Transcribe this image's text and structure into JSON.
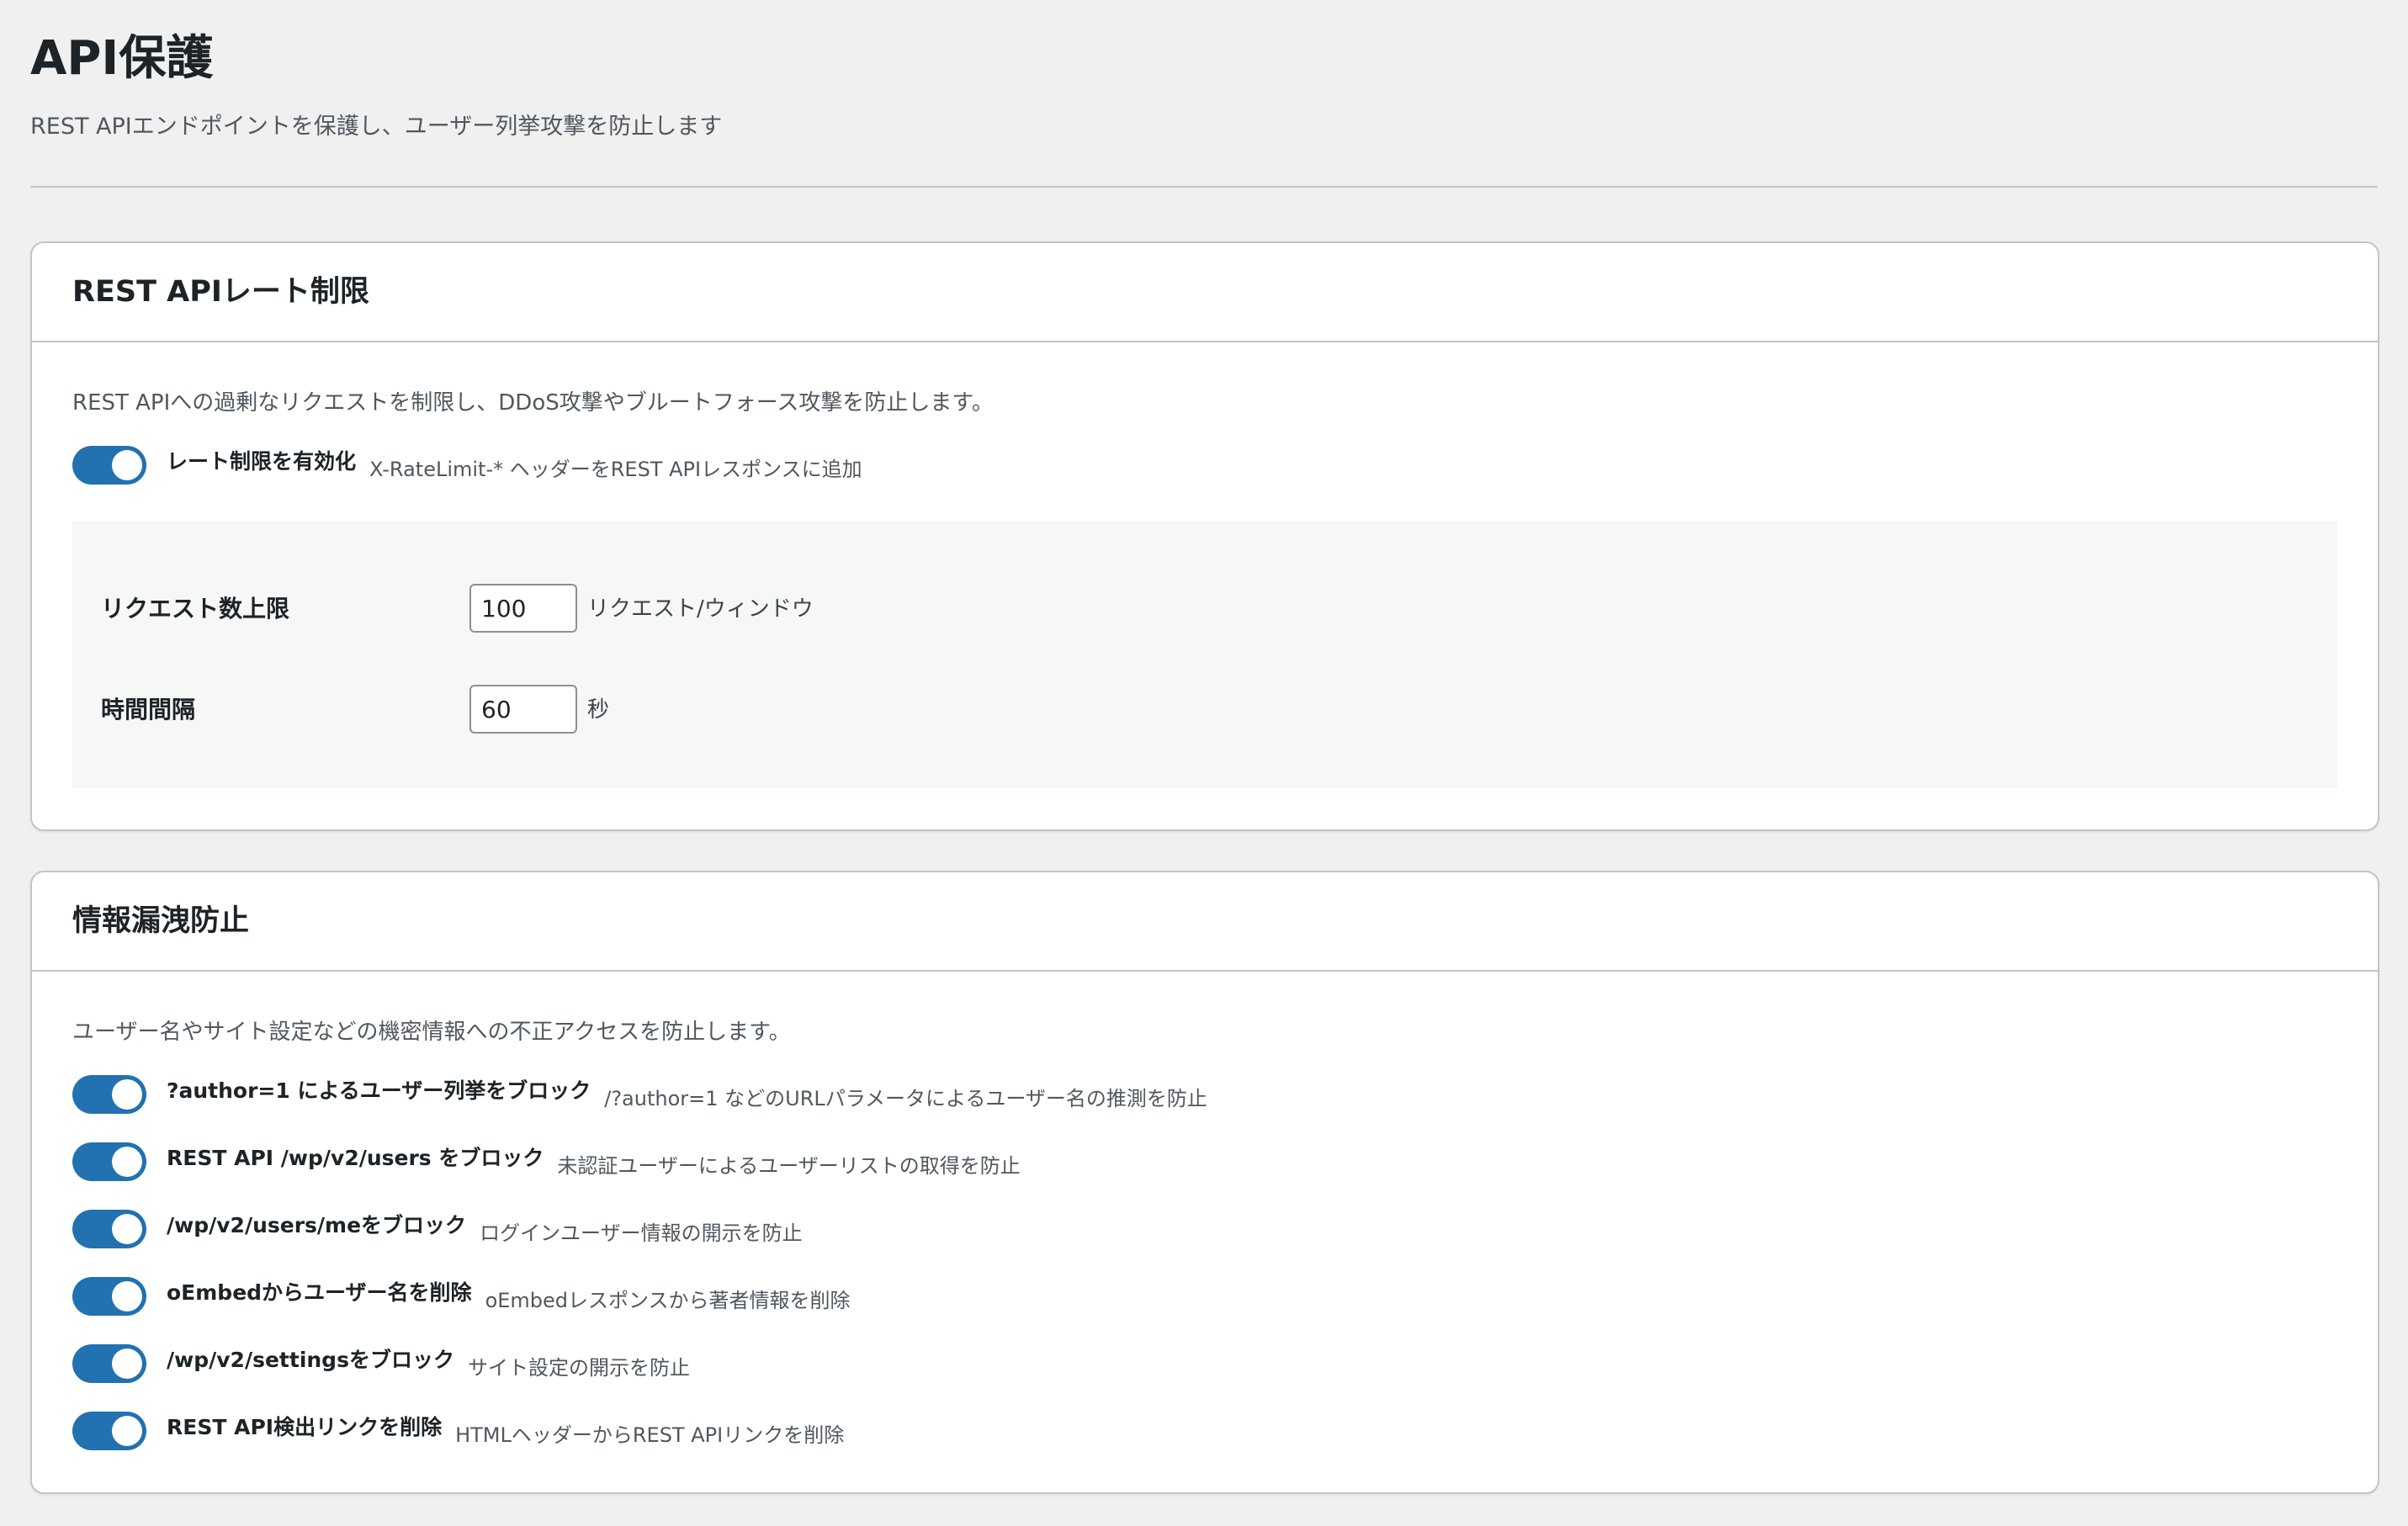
{
  "page": {
    "title": "API保護",
    "description": "REST APIエンドポイントを保護し、ユーザー列挙攻撃を防止します"
  },
  "colors": {
    "accent": "#2271b1",
    "background": "#f0f0f1",
    "card": "#ffffff",
    "panel": "#f6f7f7",
    "border": "#c3c4c7"
  },
  "rate_limit": {
    "title": "REST APIレート制限",
    "description": "REST APIへの過剰なリクエストを制限し、DDoS攻撃やブルートフォース攻撃を防止します。",
    "toggle": {
      "label": "レート制限を有効化",
      "hint": "X-RateLimit-* ヘッダーをREST APIレスポンスに追加",
      "checked": true
    },
    "fields": [
      {
        "label": "リクエスト数上限",
        "value": "100",
        "unit": "リクエスト/ウィンドウ"
      },
      {
        "label": "時間間隔",
        "value": "60",
        "unit": "秒"
      }
    ]
  },
  "info_leak": {
    "title": "情報漏洩防止",
    "description": "ユーザー名やサイト設定などの機密情報への不正アクセスを防止します。",
    "toggles": [
      {
        "label": "?author=1 によるユーザー列挙をブロック",
        "hint": "/?author=1 などのURLパラメータによるユーザー名の推測を防止",
        "checked": true
      },
      {
        "label": "REST API /wp/v2/users をブロック",
        "hint": "未認証ユーザーによるユーザーリストの取得を防止",
        "checked": true
      },
      {
        "label": "/wp/v2/users/meをブロック",
        "hint": "ログインユーザー情報の開示を防止",
        "checked": true
      },
      {
        "label": "oEmbedからユーザー名を削除",
        "hint": "oEmbedレスポンスから著者情報を削除",
        "checked": true
      },
      {
        "label": "/wp/v2/settingsをブロック",
        "hint": "サイト設定の開示を防止",
        "checked": true
      },
      {
        "label": "REST API検出リンクを削除",
        "hint": "HTMLヘッダーからREST APIリンクを削除",
        "checked": true
      }
    ]
  }
}
